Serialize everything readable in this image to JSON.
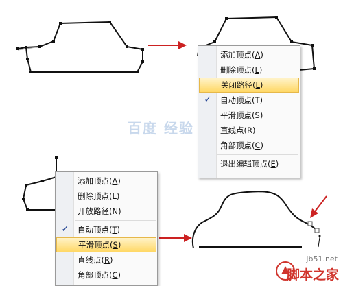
{
  "menu_top_right": {
    "items": [
      {
        "text": "添加顶点(",
        "key": "A",
        "close": ")",
        "checked": false,
        "highlighted": false,
        "sep_after": false
      },
      {
        "text": "删除顶点(",
        "key": "L",
        "close": ")",
        "checked": false,
        "highlighted": false,
        "sep_after": false
      },
      {
        "text": "关闭路径(",
        "key": "L",
        "close": ")",
        "checked": false,
        "highlighted": true,
        "sep_after": false
      },
      {
        "text": "自动顶点(",
        "key": "T",
        "close": ")",
        "checked": true,
        "highlighted": false,
        "sep_after": false
      },
      {
        "text": "平滑顶点(",
        "key": "S",
        "close": ")",
        "checked": false,
        "highlighted": false,
        "sep_after": false
      },
      {
        "text": "直线点(",
        "key": "R",
        "close": ")",
        "checked": false,
        "highlighted": false,
        "sep_after": false
      },
      {
        "text": "角部顶点(",
        "key": "C",
        "close": ")",
        "checked": false,
        "highlighted": false,
        "sep_after": true
      },
      {
        "text": "退出编辑顶点(",
        "key": "E",
        "close": ")",
        "checked": false,
        "highlighted": false,
        "sep_after": false
      }
    ]
  },
  "menu_bottom_left": {
    "items": [
      {
        "text": "添加顶点(",
        "key": "A",
        "close": ")",
        "checked": false,
        "highlighted": false,
        "sep_after": false
      },
      {
        "text": "删除顶点(",
        "key": "L",
        "close": ")",
        "checked": false,
        "highlighted": false,
        "sep_after": false
      },
      {
        "text": "开放路径(",
        "key": "N",
        "close": ")",
        "checked": false,
        "highlighted": false,
        "sep_after": true
      },
      {
        "text": "自动顶点(",
        "key": "T",
        "close": ")",
        "checked": true,
        "highlighted": false,
        "sep_after": false
      },
      {
        "text": "平滑顶点(",
        "key": "S",
        "close": ")",
        "checked": false,
        "highlighted": true,
        "sep_after": false
      },
      {
        "text": "直线点(",
        "key": "R",
        "close": ")",
        "checked": false,
        "highlighted": false,
        "sep_after": false
      },
      {
        "text": "角部顶点(",
        "key": "C",
        "close": ")",
        "checked": false,
        "highlighted": false,
        "sep_after": false
      }
    ]
  },
  "check_glyph": "✓",
  "watermark": {
    "text": "百度 经验"
  },
  "site": {
    "url": "jb51.net",
    "brand": "脚本之家"
  },
  "colors": {
    "arrow": "#cc2222",
    "highlight": "#ffd866",
    "path": "#111111"
  }
}
